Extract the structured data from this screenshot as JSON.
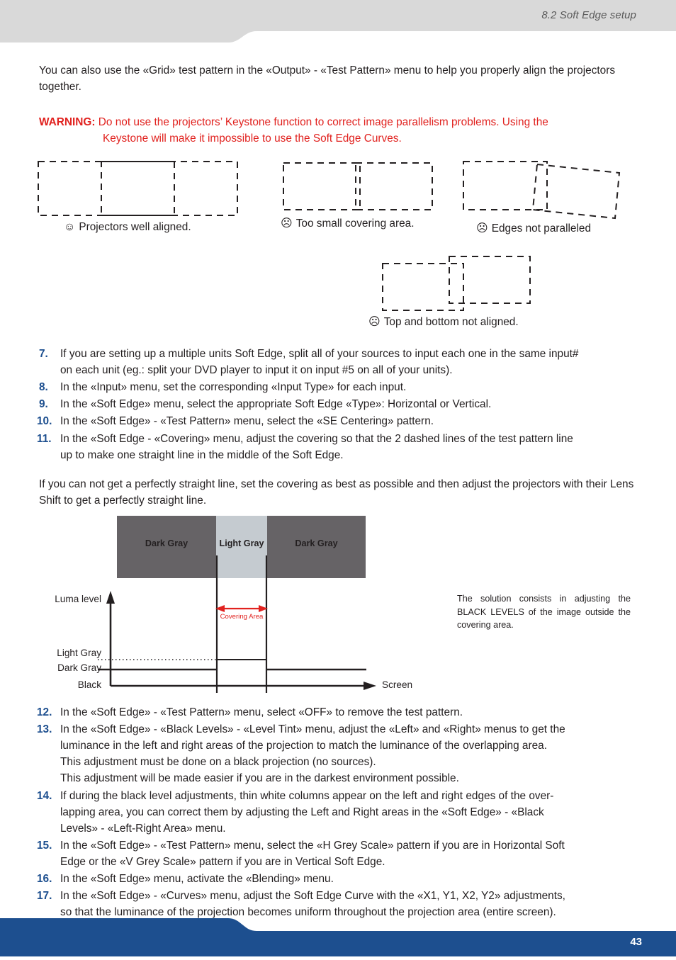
{
  "header": {
    "title": "8.2 Soft Edge setup",
    "bg_color": "#d9d9d9"
  },
  "footer": {
    "page_number": "43",
    "bg_color": "#1d4f8f"
  },
  "intro": {
    "paragraph": "You can also use the «Grid» test pattern in the «Output» - «Test Pattern» menu to help you properly align the projectors together."
  },
  "warning": {
    "label": "WARNING:",
    "line1": "Do not use the projectors’ Keystone function to correct image parallelism problems. Using the",
    "line2": "Keystone will make it impossible to use the Soft Edge Curves.",
    "color": "#e1221f"
  },
  "figures": [
    {
      "face": "☺",
      "caption": "Projectors well aligned."
    },
    {
      "face": "☹",
      "caption": "Too small covering area."
    },
    {
      "face": "☹",
      "caption": "Edges not paralleled"
    },
    {
      "face": "☹",
      "caption": "Top and bottom not aligned."
    }
  ],
  "steps_upper": [
    {
      "num": "7.",
      "lines": [
        "If you are setting up a multiple units Soft Edge, split all of your sources to input each one in the same input#",
        "on each unit (eg.: split your DVD player to input it on input #5 on all of your units)."
      ]
    },
    {
      "num": "8.",
      "lines": [
        "In the «Input» menu, set the corresponding «Input Type» for each input."
      ]
    },
    {
      "num": "9.",
      "lines": [
        "In the «Soft Edge» menu, select the appropriate Soft Edge «Type»: Horizontal or Vertical."
      ]
    },
    {
      "num": "10.",
      "lines": [
        "In the «Soft Edge» - «Test Pattern» menu, select the «SE Centering» pattern."
      ]
    },
    {
      "num": "11.",
      "lines": [
        "In the «Soft Edge - «Covering» menu, adjust the covering so that the 2 dashed lines of the test pattern line",
        "up to make one straight line in the middle of the Soft Edge."
      ]
    }
  ],
  "middle_paragraph": "If you can not get a perfectly straight line, set the covering as best as possible and then adjust the projectors with their Lens Shift to get a perfectly straight line.",
  "luma_diagram": {
    "band_labels": [
      "Dark Gray",
      "Light Gray",
      "Dark Gray"
    ],
    "y_axis_title": "Luma level",
    "x_axis_title": "Screen",
    "y_ticks": [
      "Light Gray",
      "Dark Gray",
      "Black"
    ],
    "arrow_label": "Covering Area",
    "arrow_color": "#e1221f",
    "dark_gray_color": "#666366",
    "light_gray_color": "#c5cbd0",
    "side_note": "The solution consists in adjusting the BLACK LEVELS of the image outside the covering area."
  },
  "steps_lower": [
    {
      "num": "12.",
      "lines": [
        "In the «Soft Edge» - «Test Pattern» menu, select «OFF» to remove the test pattern."
      ]
    },
    {
      "num": "13.",
      "lines": [
        "In the «Soft Edge» - «Black Levels» - «Level Tint» menu, adjust the «Left» and «Right» menus to get the",
        "luminance in the left and right areas of the projection to match the luminance of the overlapping area.",
        "This adjustment must be done on a black projection (no sources).",
        "This adjustment will be made easier if you are in the darkest environment possible."
      ]
    },
    {
      "num": "14.",
      "lines": [
        "If during the black level adjustments, thin white columns appear on the left and right edges of the over-",
        "lapping area, you can correct them by adjusting the Left and Right areas in the «Soft Edge» - «Black",
        "Levels» - «Left-Right Area» menu."
      ]
    },
    {
      "num": "15.",
      "lines": [
        "In the «Soft Edge» - «Test Pattern» menu, select the «H Grey Scale» pattern if you are in Horizontal Soft",
        "Edge or the «V Grey Scale» pattern if you are in Vertical Soft Edge."
      ]
    },
    {
      "num": "16.",
      "lines": [
        "In the «Soft Edge» menu, activate the «Blending» menu."
      ]
    },
    {
      "num": "17.",
      "lines": [
        "In the «Soft Edge» - «Curves» menu, adjust the Soft Edge Curve with the «X1, Y1, X2, Y2» adjustments,",
        "so that the luminance of the projection becomes uniform throughout the projection area (entire screen)."
      ]
    }
  ]
}
